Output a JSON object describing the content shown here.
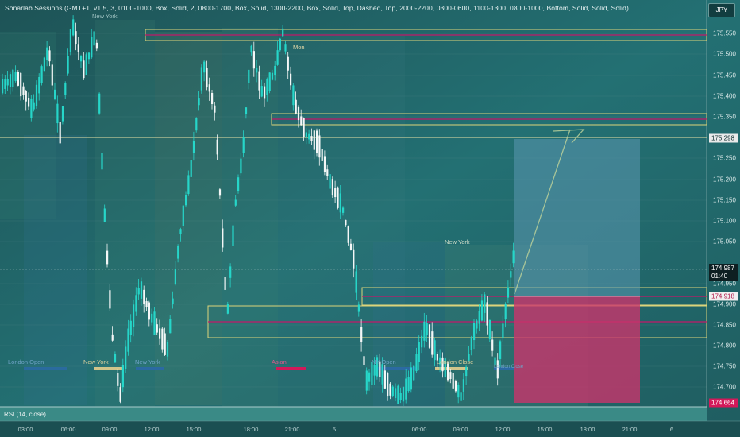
{
  "indicator": {
    "title": "Sonarlab Sessions (GMT+1, v1.5, 3, 0100-1000, Box, Solid, 2, 0800-1700, Box, Solid, 1300-2200, Box, Solid, Top, Dashed, Top, 2000-2200, 0300-0600, 1100-1300, 0800-1000, Bottom, Solid, Solid, Solid)"
  },
  "currency": "JPY",
  "price_scale": [
    "175.550",
    "175.500",
    "175.450",
    "175.400",
    "175.350",
    "175.250",
    "175.200",
    "175.150",
    "175.100",
    "175.050",
    "174.950",
    "174.900",
    "174.850",
    "174.800",
    "174.750",
    "174.700"
  ],
  "tags": {
    "level_1": "175.298",
    "level_2": "174.918",
    "current_price": "174.987",
    "countdown": "01:40",
    "stop_level": "174.664"
  },
  "session_labels": [
    "New York",
    "New York",
    "London Open",
    "New York",
    "New York",
    "Asian",
    "NY Open",
    "London Close",
    "London Close"
  ],
  "weekday_marker": "Mon",
  "rsi": {
    "label": "RSI (14, close)"
  },
  "time_axis": [
    "03:00",
    "06:00",
    "09:00",
    "12:00",
    "15:00",
    "18:00",
    "21:00",
    "5",
    "06:00",
    "09:00",
    "12:00",
    "15:00",
    "18:00",
    "21:00",
    "6"
  ],
  "colors": {
    "background": "#1f5a5d",
    "bull_candle": "#26d6c9",
    "bear_candle": "#f4f7f7",
    "box_border": "#dcd47a",
    "magenta_line": "#c2186a",
    "target_zone": "#5b97b0",
    "stop_zone": "#c9346b"
  },
  "icons": {
    "arrow": "arrow-up-right-icon"
  }
}
